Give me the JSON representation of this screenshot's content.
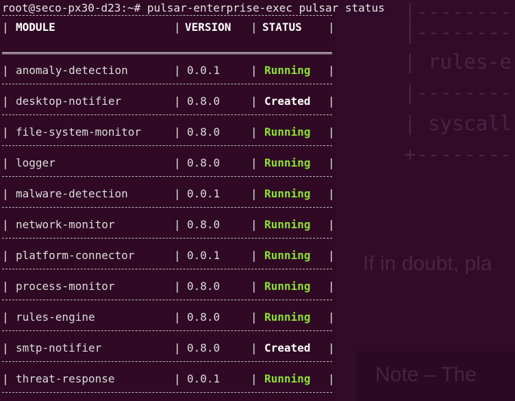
{
  "terminal": {
    "prompt": "root@seco-px30-d23:~# ",
    "command": "pulsar-enterprise-exec pulsar status"
  },
  "table": {
    "headers": {
      "module": "MODULE",
      "version": "VERSION",
      "status": "STATUS"
    },
    "rows": [
      {
        "module": "anomaly-detection",
        "version": "0.0.1",
        "status": "Running"
      },
      {
        "module": "desktop-notifier",
        "version": "0.8.0",
        "status": "Created"
      },
      {
        "module": "file-system-monitor",
        "version": "0.8.0",
        "status": "Running"
      },
      {
        "module": "logger",
        "version": "0.8.0",
        "status": "Running"
      },
      {
        "module": "malware-detection",
        "version": "0.0.1",
        "status": "Running"
      },
      {
        "module": "network-monitor",
        "version": "0.8.0",
        "status": "Running"
      },
      {
        "module": "platform-connector",
        "version": "0.0.1",
        "status": "Running"
      },
      {
        "module": "process-monitor",
        "version": "0.8.0",
        "status": "Running"
      },
      {
        "module": "rules-engine",
        "version": "0.8.0",
        "status": "Running"
      },
      {
        "module": "smtp-notifier",
        "version": "0.8.0",
        "status": "Created"
      },
      {
        "module": "threat-response",
        "version": "0.0.1",
        "status": "Running"
      }
    ]
  },
  "background": {
    "term_lines": [
      "|---------",
      "| rules-e",
      "|---------",
      "| syscall",
      "+---------"
    ],
    "prose": "If in doubt, pla",
    "note": "Note – The"
  },
  "colors": {
    "running": "#8ae234",
    "created": "#ffffff",
    "terminal_bg": "#300a24"
  }
}
